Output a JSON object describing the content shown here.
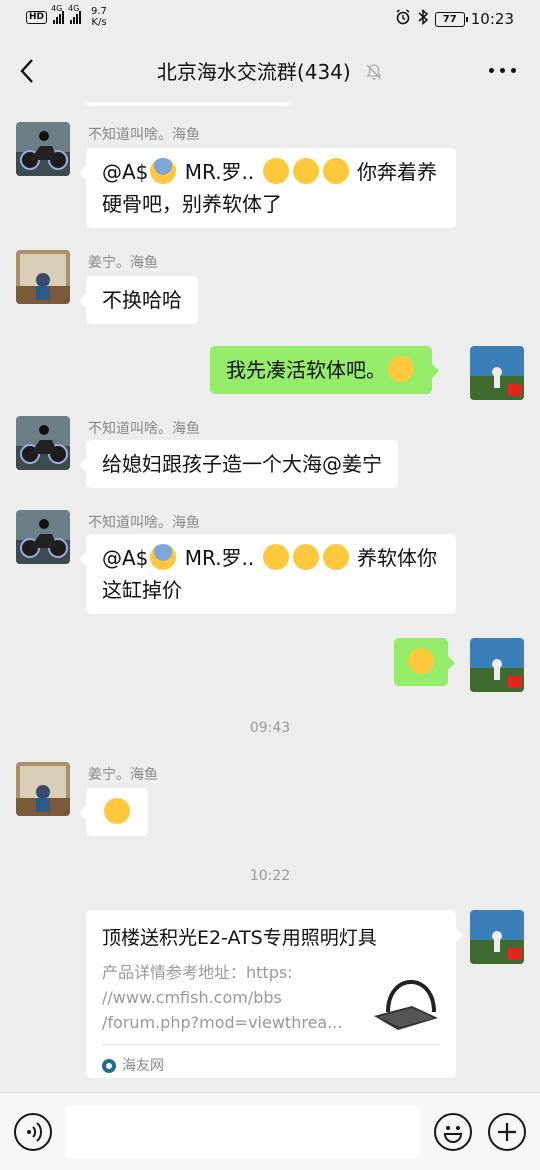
{
  "status_bar": {
    "hd_label": "HD",
    "net1": "4G",
    "net2": "4G",
    "speed_value": "9.7",
    "speed_unit": "K/s",
    "battery": "77",
    "time": "10:23"
  },
  "header": {
    "title": "北京海水交流群(434)",
    "muted": true
  },
  "messages": [
    {
      "sender": "不知道叫啥。海鱼",
      "text_pre": "@A$",
      "text_mid": " MR.罗.. ",
      "text_post": " 你奔着养硬骨吧，别养软体了"
    },
    {
      "sender": "姜宁。海鱼",
      "text": "不换哈哈"
    },
    {
      "text": "我先凑活软体吧。"
    },
    {
      "sender": "不知道叫啥。海鱼",
      "text": "给媳妇跟孩子造一个大海@姜宁"
    },
    {
      "sender": "不知道叫啥。海鱼",
      "text_pre": "@A$",
      "text_mid": " MR.罗.. ",
      "text_post": " 养软体你这缸掉价"
    },
    {
      "timestamp": "09:43"
    },
    {
      "sender": "姜宁。海鱼"
    },
    {
      "timestamp": "10:22"
    },
    {
      "card_title": "顶楼送积光E2-ATS专用照明灯具",
      "card_desc": "产品详情参考地址：https://www.cmfish.com/bbs/forum.php?mod=viewthrea...",
      "card_desc_line1": "产品详情参考地址：https:",
      "card_desc_line2": "//www.cmfish.com/bbs",
      "card_desc_line3": "/forum.php?mod=viewthrea...",
      "card_source": "海友网"
    }
  ],
  "colors": {
    "background": "#ededed",
    "my_bubble": "#95ec69",
    "other_bubble": "#ffffff"
  },
  "icons": {
    "back": "chevron-left-icon",
    "mute": "bell-off-icon",
    "more": "more-dots-icon",
    "voice": "voice-icon",
    "emoji": "emoji-icon",
    "plus": "plus-icon"
  }
}
